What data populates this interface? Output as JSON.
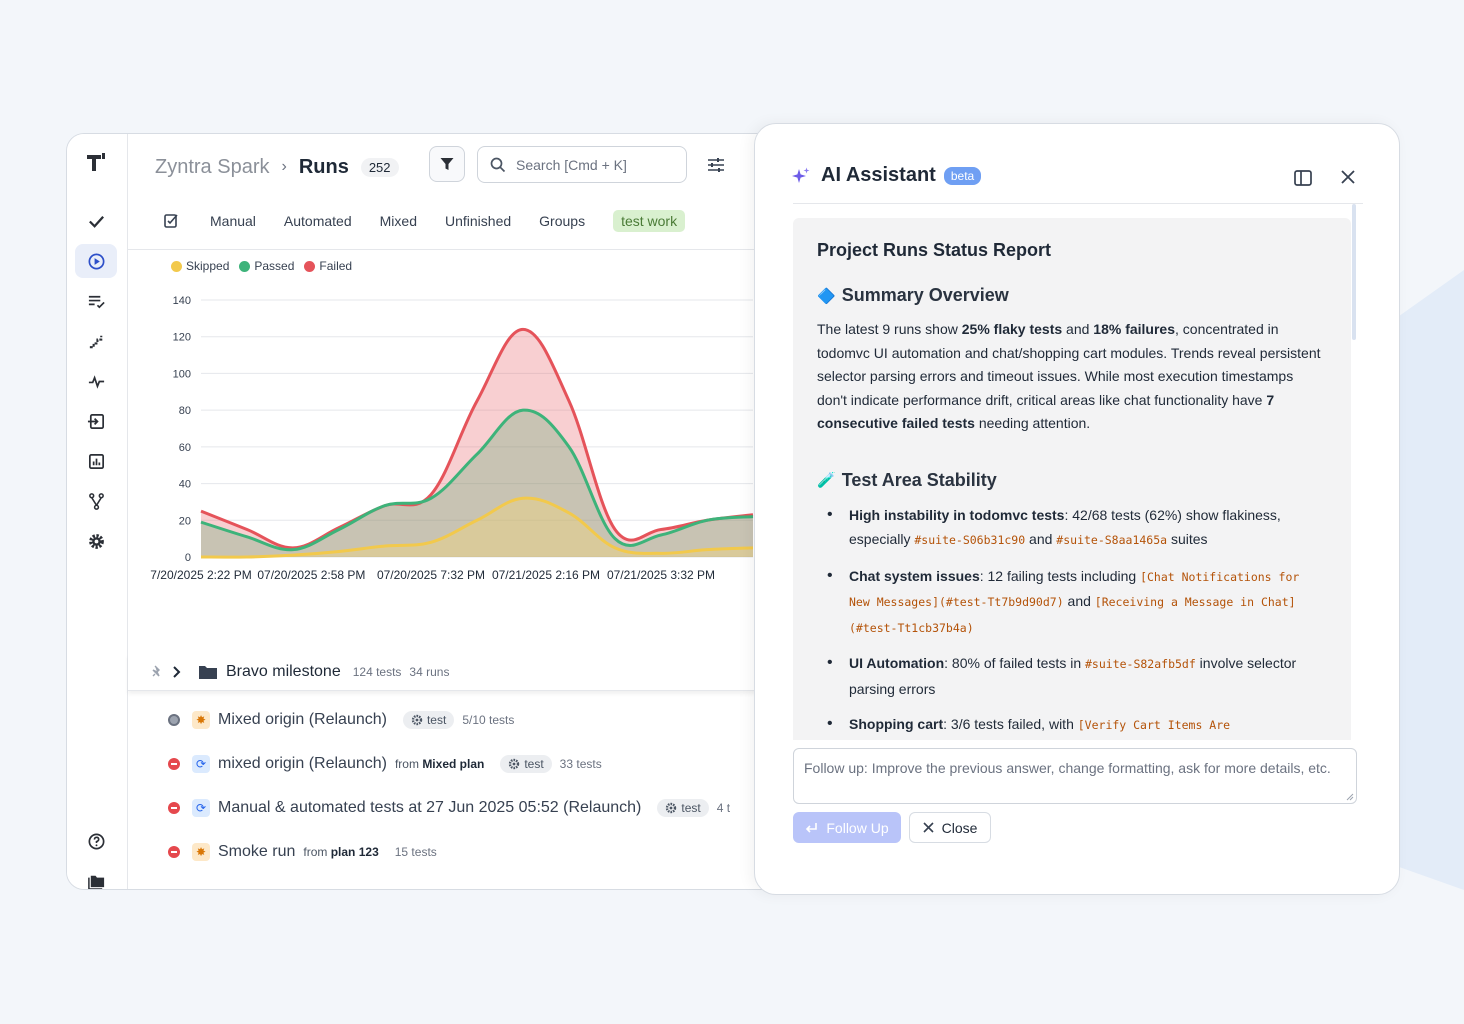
{
  "app": {
    "breadcrumb_root": "Zyntra Spark",
    "breadcrumb_sep": "›",
    "breadcrumb_current": "Runs",
    "runs_count": "252",
    "search_placeholder": "Search [Cmd + K]",
    "tabs": [
      "Manual",
      "Automated",
      "Mixed",
      "Unfinished",
      "Groups"
    ],
    "active_tag": "test work"
  },
  "sidebar": {
    "icons": [
      "checkmark-icon",
      "play-circle-icon",
      "list-check-icon",
      "steps-icon",
      "pulse-icon",
      "import-icon",
      "analytics-icon",
      "branch-icon",
      "gear-icon",
      "help-icon",
      "folders-icon"
    ],
    "active": "play-circle-icon"
  },
  "chart_data": {
    "type": "area",
    "legend": [
      {
        "name": "Skipped",
        "color": "#f2c94c"
      },
      {
        "name": "Passed",
        "color": "#3db37a"
      },
      {
        "name": "Failed",
        "color": "#e5535a"
      }
    ],
    "x_tick_labels": [
      "7/20/2025 2:22 PM",
      "07/20/2025 2:58 PM",
      "07/20/2025 7:32 PM",
      "07/21/2025 2:16 PM",
      "07/21/2025 3:32 PM"
    ],
    "y_ticks": [
      0,
      20,
      40,
      60,
      80,
      100,
      120,
      140
    ],
    "ylim": [
      0,
      140
    ],
    "x": [
      0,
      1,
      2,
      3,
      4,
      5,
      6,
      7,
      8,
      9,
      10,
      11,
      12
    ],
    "series": [
      {
        "name": "Skipped",
        "values": [
          0,
          0,
          1,
          3,
          6,
          8,
          20,
          32,
          24,
          5,
          2,
          4,
          5
        ]
      },
      {
        "name": "Passed",
        "values": [
          19,
          11,
          4,
          15,
          28,
          32,
          56,
          80,
          60,
          10,
          12,
          20,
          22
        ]
      },
      {
        "name": "Failed",
        "values": [
          25,
          15,
          5,
          16,
          28,
          34,
          85,
          124,
          85,
          15,
          15,
          20,
          23
        ]
      }
    ]
  },
  "list": {
    "group": {
      "title": "Bravo milestone",
      "tests": "124 tests",
      "runs": "34 runs"
    },
    "runs": [
      {
        "title": "Mixed origin (Relaunch)",
        "status": "mixed",
        "type": "manual",
        "from_label": "",
        "from_plan": "",
        "tag": "test",
        "count": "5/10 tests"
      },
      {
        "title": "mixed origin (Relaunch)",
        "status": "failed",
        "type": "auto",
        "from_label": "from",
        "from_plan": "Mixed plan",
        "tag": "test",
        "count": "33 tests"
      },
      {
        "title": "Manual & automated tests at 27 Jun 2025 05:52 (Relaunch)",
        "status": "failed",
        "type": "auto",
        "from_label": "",
        "from_plan": "",
        "tag": "test",
        "count": "4 t"
      },
      {
        "title": "Smoke run",
        "status": "failed",
        "type": "manual",
        "from_label": "from",
        "from_plan": "plan 123",
        "tag": "",
        "count": "15 tests"
      }
    ]
  },
  "assistant": {
    "title": "AI Assistant",
    "badge": "beta",
    "report_title": "Project Runs Status Report",
    "summary_heading": "Summary Overview",
    "summary": {
      "t1": "The latest 9 runs show ",
      "b1": "25% flaky tests",
      "t2": " and ",
      "b2": "18% failures",
      "t3": ", concentrated in todomvc UI automation and chat/shopping cart modules. Trends reveal persistent selector parsing errors and timeout issues. While most execution timestamps don't indicate performance drift, critical areas like chat functionality have ",
      "b3": "7 consecutive failed tests",
      "t4": " needing attention."
    },
    "stability_heading": "Test Area Stability",
    "bullets": {
      "b1_strong": "High instability in todomvc tests",
      "b1_text": ": 42/68 tests (62%) show flakiness, especially ",
      "b1_code1": "#suite-S06b31c90",
      "b1_and": " and ",
      "b1_code2": "#suite-S8aa1465a",
      "b1_end": " suites",
      "b2_strong": "Chat system issues",
      "b2_text": ": 12 failing tests including ",
      "b2_code1": "[Chat Notifications for New Messages](#test-Tt7b9d90d7)",
      "b2_and": " and ",
      "b2_code2": "[Receiving a Message in Chat](#test-Tt1cb37b4a)",
      "b3_strong": "UI Automation",
      "b3_text": ": 80% of failed tests in ",
      "b3_code": "#suite-S82afb5df",
      "b3_end": " involve selector parsing errors",
      "b4_strong": "Shopping cart",
      "b4_text": ": 3/6 tests failed, with ",
      "b4_code": "[Verify Cart Items Are"
    },
    "followup_placeholder": "Follow up: Improve the previous answer, change formatting, ask for more details, etc.",
    "follow_up_button": "Follow Up",
    "close_button": "Close"
  }
}
